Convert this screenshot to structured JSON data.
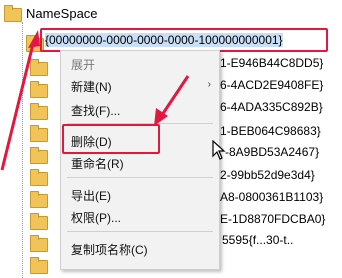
{
  "tree": {
    "root_label": "NameSpace",
    "selected_key": "{00000000-0000-0000-0000-100000000001}",
    "visible_suffixes": [
      "1-E946B44C8DD5}",
      "6-4ACD2E9408FE}",
      "6-4ADA335C892B}",
      "1-BEB064C98683}",
      "-8A9BD53A2467}",
      "2-99bb52d9e3d4}",
      "A8-0800361B1103}",
      "E-1D8870FDCBA0}",
      "5595{f...30-t.."
    ]
  },
  "context_menu": {
    "items": [
      {
        "label": "展开",
        "disabled": true
      },
      {
        "label": "新建(N)",
        "has_submenu": true,
        "submenu_glyph": "›"
      },
      {
        "label": "查找(F)..."
      },
      {
        "label": "删除(D)"
      },
      {
        "label": "重命名(R)"
      },
      {
        "label": "导出(E)"
      },
      {
        "label": "权限(P)..."
      },
      {
        "label": "复制项名称(C)"
      }
    ]
  },
  "annotations": {
    "highlight_color": "#e3173f"
  }
}
